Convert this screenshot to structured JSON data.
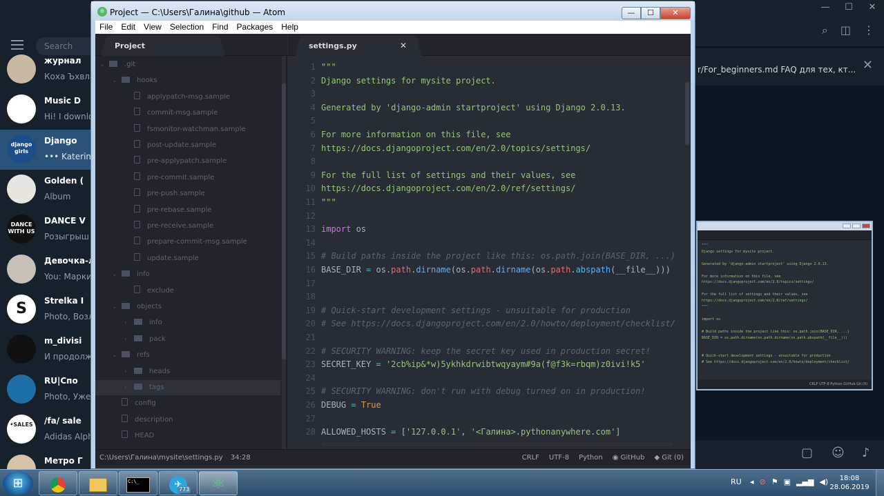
{
  "telegram": {
    "search_placeholder": "Search",
    "chats": [
      {
        "name": "журнал",
        "message": "Коха Ъхвла",
        "type": "group",
        "active": false
      },
      {
        "name": "Music D",
        "message": "Hi! I downlo",
        "type": "channel",
        "active": false
      },
      {
        "name": "Django",
        "message": "••• Katerina",
        "type": "group",
        "active": true,
        "avatar_text": "django girls"
      },
      {
        "name": "Golden (",
        "message": "Album",
        "type": "channel",
        "active": false
      },
      {
        "name": "DANCE V",
        "message": "Розыгрыш",
        "type": "channel",
        "active": false,
        "avatar_text": "DANCE WITH US"
      },
      {
        "name": "Девочка-ле",
        "message": "You: Марки",
        "type": "chat",
        "active": false
      },
      {
        "name": "Strelka I",
        "message": "Photo, Возл",
        "type": "channel",
        "active": false,
        "avatar_text": "S"
      },
      {
        "name": "m_divisi",
        "message": "И продолжа",
        "type": "channel",
        "active": false
      },
      {
        "name": "RU|Спо",
        "message": "Photo, Уже",
        "type": "channel",
        "active": false
      },
      {
        "name": "/fa/ sale",
        "message": "Adidas Alph",
        "type": "channel",
        "active": false,
        "avatar_text": "•SALES"
      },
      {
        "name": "Метро Г",
        "message": "",
        "type": "channel",
        "active": false
      }
    ],
    "pinned": "r/For_beginners.md  FAQ для тех, кт...",
    "mini_preview": {
      "code": "\"\"\"\nDjango settings for mysite project.\n\nGenerated by 'django-admin startproject' using Django 2.0.13.\n\nFor more information on this file, see\nhttps://docs.djangoproject.com/en/2.0/topics/settings/\n\nFor the full list of settings and their values, see\nhttps://docs.djangoproject.com/en/2.0/ref/settings/\n\"\"\"\n\nimport os\n\n# Build paths inside the project like this: os.path.join(BASE_DIR, ...)\nBASE_DIR = os.path.dirname(os.path.dirname(os.path.abspath(__file__)))\n\n\n# Quick-start development settings - unsuitable for production\n# See https://docs.djangoproject.com/en/2.0/howto/deployment/checklist/",
      "status": "CRLF   UTF-8   Python   GitHub   Git (0)"
    }
  },
  "atom": {
    "title": "Project — C:\\Users\\Галина\\github — Atom",
    "menu": [
      "File",
      "Edit",
      "View",
      "Selection",
      "Find",
      "Packages",
      "Help"
    ],
    "tree_tab": "Project",
    "editor_tab": "settings.py",
    "tree": [
      {
        "label": ".git",
        "kind": "folder",
        "depth": 0,
        "open": true
      },
      {
        "label": "hooks",
        "kind": "folder",
        "depth": 1,
        "open": true
      },
      {
        "label": "applypatch-msg.sample",
        "kind": "file",
        "depth": 2
      },
      {
        "label": "commit-msg.sample",
        "kind": "file",
        "depth": 2
      },
      {
        "label": "fsmonitor-watchman.sample",
        "kind": "file",
        "depth": 2
      },
      {
        "label": "post-update.sample",
        "kind": "file",
        "depth": 2
      },
      {
        "label": "pre-applypatch.sample",
        "kind": "file",
        "depth": 2
      },
      {
        "label": "pre-commit.sample",
        "kind": "file",
        "depth": 2
      },
      {
        "label": "pre-push.sample",
        "kind": "file",
        "depth": 2
      },
      {
        "label": "pre-rebase.sample",
        "kind": "file",
        "depth": 2
      },
      {
        "label": "pre-receive.sample",
        "kind": "file",
        "depth": 2
      },
      {
        "label": "prepare-commit-msg.sample",
        "kind": "file",
        "depth": 2
      },
      {
        "label": "update.sample",
        "kind": "file",
        "depth": 2
      },
      {
        "label": "info",
        "kind": "folder",
        "depth": 1,
        "open": true
      },
      {
        "label": "exclude",
        "kind": "file",
        "depth": 2
      },
      {
        "label": "objects",
        "kind": "folder",
        "depth": 1,
        "open": true
      },
      {
        "label": "info",
        "kind": "folder",
        "depth": 2,
        "open": false
      },
      {
        "label": "pack",
        "kind": "folder",
        "depth": 2,
        "open": false
      },
      {
        "label": "refs",
        "kind": "folder",
        "depth": 1,
        "open": true
      },
      {
        "label": "heads",
        "kind": "folder",
        "depth": 2,
        "open": false
      },
      {
        "label": "tags",
        "kind": "folder",
        "depth": 2,
        "open": false,
        "selected": true
      },
      {
        "label": "config",
        "kind": "file",
        "depth": 1
      },
      {
        "label": "description",
        "kind": "file",
        "depth": 1
      },
      {
        "label": "HEAD",
        "kind": "file",
        "depth": 1
      }
    ],
    "code_lines": [
      [
        [
          "c-str",
          "\"\"\""
        ]
      ],
      [
        [
          "c-str",
          "Django settings for mysite project."
        ]
      ],
      [],
      [
        [
          "c-str",
          "Generated by 'django-admin startproject' using Django 2.0.13."
        ]
      ],
      [],
      [
        [
          "c-str",
          "For more information on this file, see"
        ]
      ],
      [
        [
          "c-str",
          "https://docs.djangoproject.com/en/2.0/topics/settings/"
        ]
      ],
      [],
      [
        [
          "c-str",
          "For the full list of settings and their values, see"
        ]
      ],
      [
        [
          "c-str",
          "https://docs.djangoproject.com/en/2.0/ref/settings/"
        ]
      ],
      [
        [
          "c-str",
          "\"\"\""
        ]
      ],
      [],
      [
        [
          "c-kw",
          "import"
        ],
        [
          "c-id",
          " os"
        ]
      ],
      [],
      [
        [
          "c-cm",
          "# Build paths inside the project like this: os.path.join(BASE_DIR, ...)"
        ]
      ],
      [
        [
          "c-id",
          "BASE_DIR "
        ],
        [
          "c-op",
          "="
        ],
        [
          "c-id",
          " os."
        ],
        [
          "c-at",
          "path"
        ],
        [
          "c-id",
          "."
        ],
        [
          "c-fn",
          "dirname"
        ],
        [
          "c-id",
          "(os."
        ],
        [
          "c-at",
          "path"
        ],
        [
          "c-id",
          "."
        ],
        [
          "c-fn",
          "dirname"
        ],
        [
          "c-id",
          "(os."
        ],
        [
          "c-at",
          "path"
        ],
        [
          "c-id",
          "."
        ],
        [
          "c-fn",
          "abspath"
        ],
        [
          "c-id",
          "(__file__)))"
        ]
      ],
      [],
      [],
      [
        [
          "c-cm",
          "# Quick-start development settings - unsuitable for production"
        ]
      ],
      [
        [
          "c-cm",
          "# See https://docs.djangoproject.com/en/2.0/howto/deployment/checklist/"
        ]
      ],
      [],
      [
        [
          "c-cm",
          "# SECURITY WARNING: keep the secret key used in production secret!"
        ]
      ],
      [
        [
          "c-id",
          "SECRET_KEY "
        ],
        [
          "c-op",
          "="
        ],
        [
          "c-id",
          " "
        ],
        [
          "c-str",
          "'2cb%ip&*w)5ykhkdrwibtwqyaym#9a(f@f3k=rbqm)z0ivi!k5'"
        ]
      ],
      [],
      [
        [
          "c-cm",
          "# SECURITY WARNING: don't run with debug turned on in production!"
        ]
      ],
      [
        [
          "c-id",
          "DEBUG "
        ],
        [
          "c-op",
          "="
        ],
        [
          "c-id",
          " "
        ],
        [
          "c-const",
          "True"
        ]
      ],
      [],
      [
        [
          "c-id",
          "ALLOWED_HOSTS "
        ],
        [
          "c-op",
          "="
        ],
        [
          "c-id",
          " ["
        ],
        [
          "c-str",
          "'127.0.0.1'"
        ],
        [
          "c-id",
          ", "
        ],
        [
          "c-str",
          "'<Галина>.pythonanywhere.com'"
        ],
        [
          "c-id",
          "]"
        ]
      ]
    ],
    "status": {
      "path": "C:\\Users\\Галина\\mysite\\settings.py",
      "cursor": "34:28",
      "line_ending": "CRLF",
      "encoding": "UTF-8",
      "grammar": "Python",
      "github": "GitHub",
      "git": "Git (0)"
    }
  },
  "taskbar": {
    "language": "RU",
    "time": "18:08",
    "date": "28.06.2019",
    "telegram_badge": "773",
    "cmd_text": "C:\\_"
  }
}
